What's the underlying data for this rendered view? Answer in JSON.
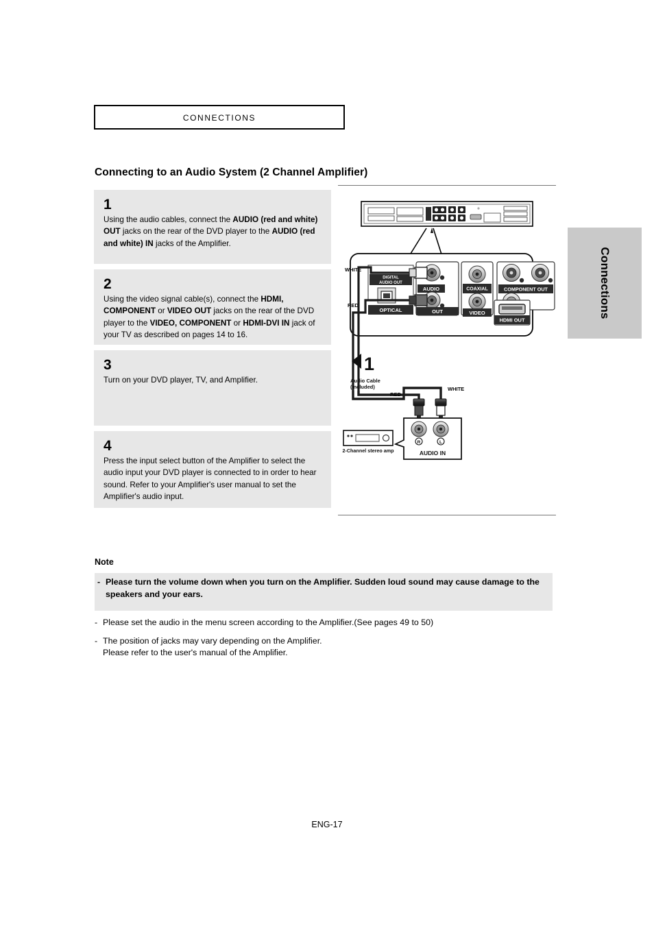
{
  "page": {
    "chapter_title": "Connections",
    "side_tab_label": "Connections",
    "footer": "ENG-17",
    "section_heading": "Connecting to an Audio System (2 Channel Amplifier)"
  },
  "steps": [
    {
      "number": "1",
      "parts": [
        {
          "t": "Using the audio cables, connect the ",
          "b": false
        },
        {
          "t": "AUDIO (red and white) OUT",
          "b": true
        },
        {
          "t": " jacks on the rear of the DVD player to the ",
          "b": false
        },
        {
          "t": "AUDIO (red and white) IN",
          "b": true
        },
        {
          "t": " jacks of the Amplifier.",
          "b": false
        }
      ]
    },
    {
      "number": "2",
      "parts": [
        {
          "t": "Using the video signal cable(s), connect the ",
          "b": false
        },
        {
          "t": "HDMI, COMPONENT",
          "b": true
        },
        {
          "t": " or ",
          "b": false
        },
        {
          "t": "VIDEO OUT",
          "b": true
        },
        {
          "t": " jacks on the rear of the DVD player to the ",
          "b": false
        },
        {
          "t": "VIDEO, COMPONENT",
          "b": true
        },
        {
          "t": " or ",
          "b": false
        },
        {
          "t": "HDMI-DVI IN",
          "b": true
        },
        {
          "t": " jack of your TV as described on pages 14 to 16.",
          "b": false
        }
      ]
    },
    {
      "number": "3",
      "parts": [
        {
          "t": "Turn on your DVD player, TV, and Amplifier.",
          "b": false
        }
      ]
    },
    {
      "number": "4",
      "parts": [
        {
          "t": "Press the input select button of the Amplifier to select the audio input your DVD player is connected to in order to hear sound. Refer to your Amplifier's user manual to set the Amplifier's audio input.",
          "b": false
        }
      ]
    }
  ],
  "note": {
    "title": "Note",
    "items": [
      {
        "dash": "-",
        "bold": true,
        "highlight": true,
        "text": "Please turn the volume down when you turn on the Amplifier. Sudden loud sound may cause damage to the speakers and your ears."
      },
      {
        "dash": "-",
        "bold": false,
        "highlight": false,
        "text": "Please set the audio in the menu screen according to the Amplifier.(See pages 49 to 50)"
      },
      {
        "dash": "-",
        "bold": false,
        "highlight": false,
        "text": "The position of jacks may vary depending on the Amplifier.",
        "text2": "Please refer to the user's manual of the Amplifier."
      }
    ]
  },
  "diagram": {
    "callout_number": "1",
    "labels": {
      "white_left": "WHITE",
      "red_left": "RED",
      "digital_audio_out": "DIGITAL AUDIO OUT",
      "optical": "OPTICAL",
      "coaxial": "COAXIAL",
      "audio": "AUDIO",
      "video": "VIDEO",
      "out": "OUT",
      "component_out": "COMPONENT OUT",
      "hdmi_out": "HDMI OUT",
      "audio_cable_line1": "Audio Cable",
      "audio_cable_line2": "(Included)",
      "red_plug": "RED",
      "white_plug": "WHITE",
      "audio_in": "AUDIO IN",
      "amp_caption": "2-Channel stereo amp",
      "jack_r": "R",
      "jack_l": "L"
    },
    "colors": {
      "panel_fill": "#ffffff",
      "jack_dark": "#3c3c3c",
      "label_fill": "#2b2b2b",
      "cable_black": "#1a1a1a"
    }
  }
}
